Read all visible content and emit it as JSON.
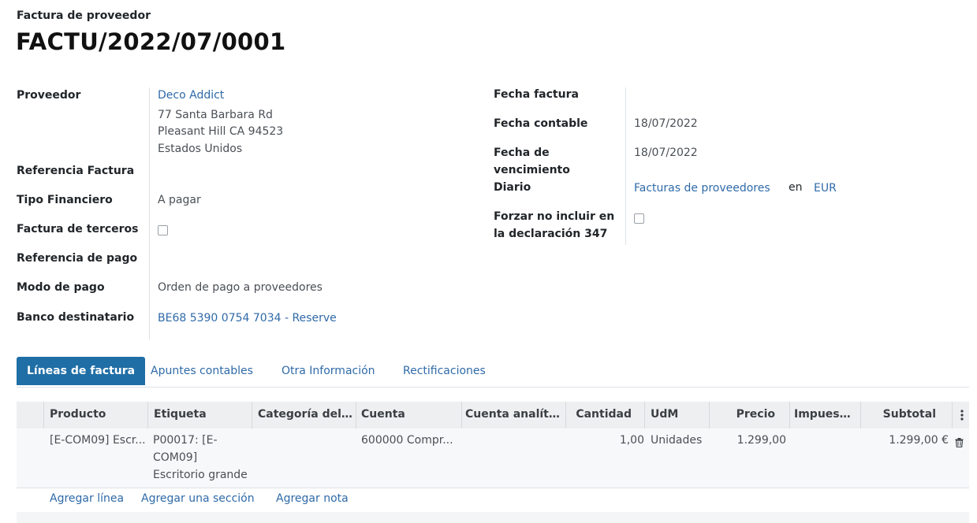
{
  "header": {
    "subtitle": "Factura de proveedor",
    "title": "FACTU/2022/07/0001"
  },
  "left_fields": {
    "proveedor_label": "Proveedor",
    "proveedor_name": "Deco Addict",
    "address_line1": "77 Santa Barbara Rd",
    "address_line2": "Pleasant Hill CA 94523",
    "address_line3": "Estados Unidos",
    "ref_factura_label": "Referencia Factura",
    "tipo_label": "Tipo Financiero",
    "tipo_value": "A pagar",
    "terceros_label": "Factura de terceros",
    "ref_pago_label": "Referencia de pago",
    "modo_label": "Modo de pago",
    "modo_value": "Orden de pago a proveedores",
    "banco_label": "Banco destinatario",
    "banco_value": "BE68 5390 0754 7034 - Reserve"
  },
  "right_fields": {
    "fecha_factura_label": "Fecha factura",
    "fecha_contable_label": "Fecha contable",
    "fecha_contable_value": "18/07/2022",
    "vencimiento_label_1": "Fecha de",
    "vencimiento_label_2": "vencimiento",
    "vencimiento_value": "18/07/2022",
    "diario_label": "Diario",
    "diario_value": "Facturas de proveedores",
    "diario_en": "en",
    "currency": "EUR",
    "forzar_label_1": "Forzar no incluir en",
    "forzar_label_2": "la declaración 347"
  },
  "tabs": {
    "lineas": "Líneas de factura",
    "apuntes": "Apuntes contables",
    "otra": "Otra Información",
    "rectificaciones": "Rectificaciones"
  },
  "table": {
    "headers": [
      "Producto",
      "Etiqueta",
      "Categoría del I...",
      "Cuenta",
      "Cuenta analíti...",
      "Cantidad",
      "UdM",
      "Precio",
      "Impuest...",
      "Subtotal"
    ],
    "row": {
      "producto": "[E-COM09] Escr...",
      "etiqueta_1": "P00017: [E-",
      "etiqueta_2": "COM09]",
      "etiqueta_3": "Escritorio grande",
      "cuenta": "600000 Compr...",
      "cantidad": "1,00",
      "udm": "Unidades",
      "precio": "1.299,00",
      "subtotal": "1.299,00 €"
    },
    "actions": {
      "add_line": "Agregar línea",
      "add_section": "Agregar una sección",
      "add_note": "Agregar nota"
    }
  },
  "icons": {
    "trash": "trash-icon",
    "kebab": "column-options-icon"
  },
  "colors": {
    "accent": "#1f6ea6",
    "link": "#2f6aa8"
  }
}
